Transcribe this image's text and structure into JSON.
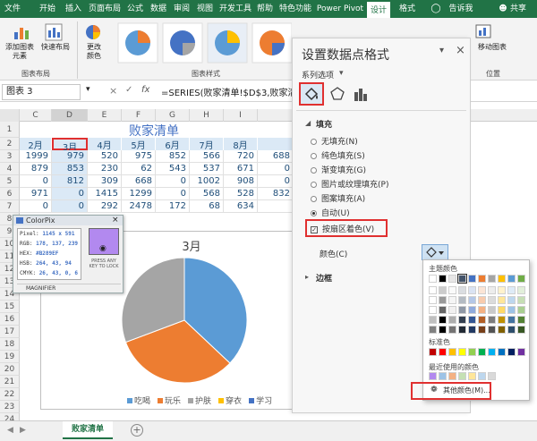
{
  "menubar": {
    "tabs": [
      "文件",
      "开始",
      "插入",
      "页面布局",
      "公式",
      "数据",
      "审阅",
      "视图",
      "开发工具",
      "帮助",
      "特色功能",
      "Power Pivot",
      "设计",
      "格式"
    ],
    "tell_me": "告诉我",
    "share": "共享"
  },
  "ribbon": {
    "add_element": "添加图表",
    "add_element2": "元素",
    "quick_layout": "快速布局",
    "change_colors": "更改",
    "change_colors2": "颜色",
    "group_layout": "图表布局",
    "group_styles": "图表样式",
    "move_chart": "移动图表",
    "group_location": "位置"
  },
  "formulabar": {
    "namebox": "图表 3",
    "cancel": "×",
    "enter": "✓",
    "fx": "fx",
    "formula": "=SERIES(败家清单!$D$3,败家清单!"
  },
  "columns": [
    "C",
    "D",
    "E",
    "F",
    "G",
    "H",
    "I"
  ],
  "rows": [
    "1",
    "2",
    "3",
    "4",
    "5",
    "6",
    "7",
    "8",
    "9",
    "10",
    "11",
    "12",
    "13",
    "14",
    "15",
    "16",
    "17",
    "18",
    "19",
    "20",
    "21",
    "22",
    "23",
    "24"
  ],
  "sheet_title": "败家清单",
  "month_headers": [
    "2月",
    "3月",
    "4月",
    "5月",
    "6月",
    "7月",
    "8月"
  ],
  "table": [
    [
      "1999",
      "979",
      "520",
      "975",
      "852",
      "566",
      "720",
      "688"
    ],
    [
      "879",
      "853",
      "230",
      "62",
      "543",
      "537",
      "671",
      "0"
    ],
    [
      "0",
      "812",
      "309",
      "668",
      "0",
      "1002",
      "908",
      "0"
    ],
    [
      "971",
      "0",
      "1415",
      "1299",
      "0",
      "568",
      "528",
      "832"
    ],
    [
      "0",
      "0",
      "292",
      "2478",
      "172",
      "68",
      "634",
      ""
    ]
  ],
  "colorpix": {
    "title": "ColorPix",
    "pixel": "Pixel:",
    "pixel_val": "1145 x 591",
    "rgb": "RGB:",
    "rgb_val": "178, 137, 239",
    "hex": "HEX:",
    "hex_val": "#B289EF",
    "hsb": "HSB:",
    "hsb_val": "264, 43, 94",
    "cmyk": "CMYK:",
    "cmyk_val": "26, 43, 0, 6",
    "press": "PRESS ANY KEY TO LOCK",
    "magnifier": "MAGNIFIER",
    "swatch_color": "#B289EF"
  },
  "chart_data": {
    "type": "pie",
    "title": "3月",
    "categories": [
      "吃喝",
      "玩乐",
      "护肤",
      "穿衣",
      "学习"
    ],
    "values": [
      979,
      853,
      812,
      0,
      0
    ],
    "colors": [
      "#5b9bd5",
      "#ed7d31",
      "#a5a5a5",
      "#ffc000",
      "#4472c4"
    ],
    "legend": "bottom"
  },
  "pane": {
    "title": "设置数据点格式",
    "series_options": "系列选项",
    "fill_header": "填充",
    "options": [
      "无填充(N)",
      "纯色填充(S)",
      "渐变填充(G)",
      "图片或纹理填充(P)",
      "图案填充(A)",
      "自动(U)"
    ],
    "vary_colors": "按扇区着色(V)",
    "color_label": "颜色(C)",
    "border_header": "边框"
  },
  "palette": {
    "theme_colors": "主题颜色",
    "standard_colors": "标准色",
    "recent_colors": "最近使用的颜色",
    "more_colors": "其他颜色(M)...",
    "theme_row": [
      "#ffffff",
      "#000000",
      "#e7e6e6",
      "#44546a",
      "#4472c4",
      "#ed7d31",
      "#a5a5a5",
      "#ffc000",
      "#5b9bd5",
      "#70ad47"
    ],
    "standard_row": [
      "#c00000",
      "#ff0000",
      "#ffc000",
      "#ffff00",
      "#92d050",
      "#00b050",
      "#00b0f0",
      "#0070c0",
      "#002060",
      "#7030a0"
    ],
    "recent_row": [
      "#b289ef",
      "#9dc3e6",
      "#f4b183",
      "#c5e0b4",
      "#ffe699",
      "#bdd7ee",
      "#d9d9d9"
    ]
  },
  "statusbar": {
    "sheet_tab": "败家清单"
  }
}
